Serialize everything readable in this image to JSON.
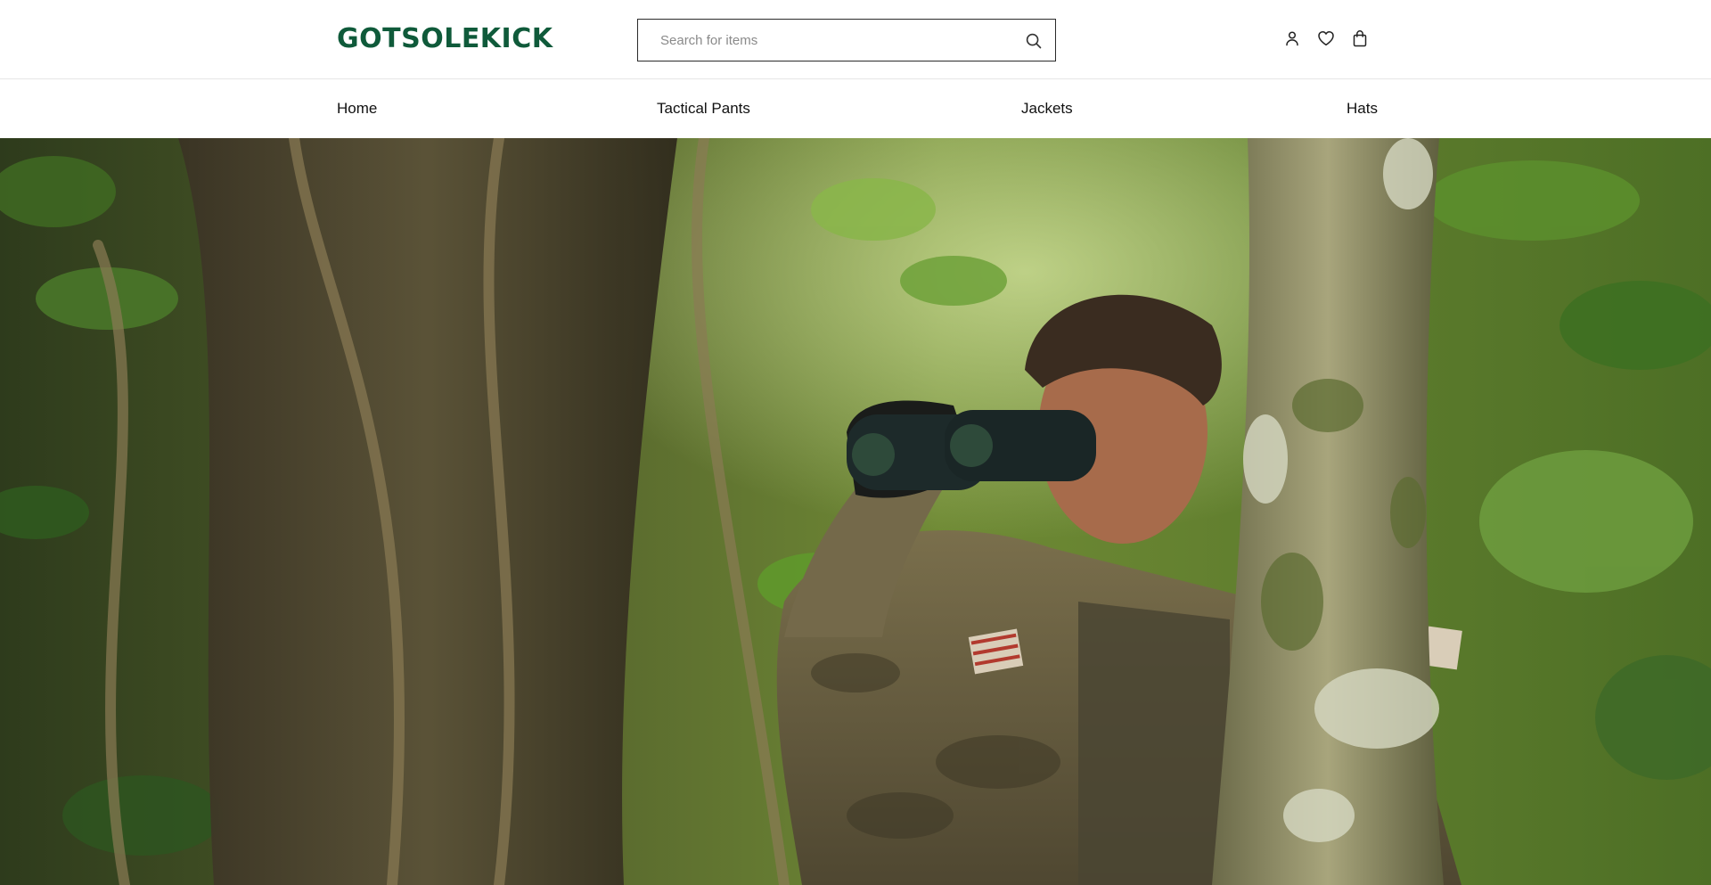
{
  "brand": {
    "logo_text": "GOTSOLEKICK",
    "color": "#0f5a3a"
  },
  "search": {
    "placeholder": "Search for items",
    "value": "",
    "icon": "search-icon"
  },
  "header_icons": [
    {
      "name": "account-icon"
    },
    {
      "name": "wishlist-icon"
    },
    {
      "name": "cart-icon"
    }
  ],
  "nav": {
    "items": [
      {
        "label": "Home"
      },
      {
        "label": "Tactical Pants"
      },
      {
        "label": "Jackets"
      },
      {
        "label": "Hats"
      }
    ]
  },
  "hero": {
    "image": "soldier-with-binoculars-in-jungle"
  }
}
